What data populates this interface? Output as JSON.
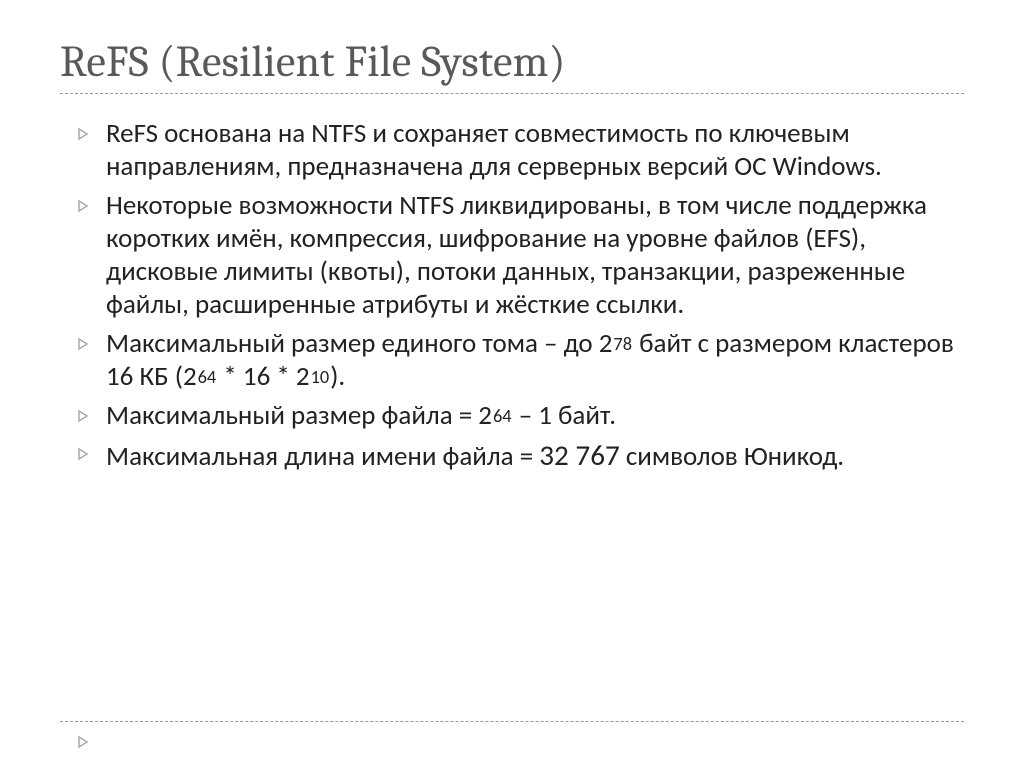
{
  "title": "ReFS (Resilient File System)",
  "bullets": {
    "b0": {
      "t0": "ReFS основана на NTFS и сохраняет совместимость по ключевым направлениям, предназначена для серверных версий ОС Windows."
    },
    "b1": {
      "t0": "Некоторые возможности NTFS ликвидированы, в том числе поддержка коротких имён, компрессия, шифрование на уровне файлов (EFS), дисковые лимиты (квоты), потоки данных, транзакции, разреженные файлы, расширенные атрибуты и жёсткие ссылки."
    },
    "b2": {
      "t0": "Максимальный размер единого тома – до 2",
      "s1": "78",
      "t2": " байт с размером кластеров 16 КБ (2",
      "s3": "64",
      "t4": " * 16 * 2",
      "s5": "10",
      "t6": ")."
    },
    "b3": {
      "t0": "Максимальный размер файла = 2",
      "s1": "64",
      "t2": " – 1 байт."
    },
    "b4": {
      "t0": "Максимальная длина имени файла = ",
      "big": "32 767",
      "t2": " символов Юникод."
    }
  }
}
